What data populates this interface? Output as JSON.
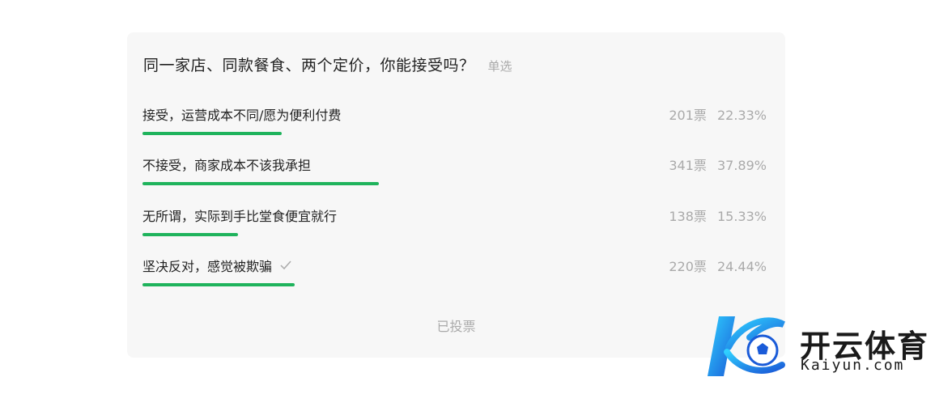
{
  "poll": {
    "question": "同一家店、同款餐食、两个定价，你能接受吗？",
    "type_label": "单选",
    "options": [
      {
        "label": "接受，运营成本不同/愿为便利付费",
        "votes": "201票",
        "percent": "22.33%",
        "fraction": 0.2233,
        "selected": false
      },
      {
        "label": "不接受，商家成本不该我承担",
        "votes": "341票",
        "percent": "37.89%",
        "fraction": 0.3789,
        "selected": false
      },
      {
        "label": "无所谓，实际到手比堂食便宜就行",
        "votes": "138票",
        "percent": "15.33%",
        "fraction": 0.1533,
        "selected": false
      },
      {
        "label": "坚决反对，感觉被欺骗",
        "votes": "220票",
        "percent": "24.44%",
        "fraction": 0.2444,
        "selected": true
      }
    ],
    "status": "已投票",
    "bar_color": "#1fb35c"
  },
  "watermark": {
    "name_cn": "开云体育",
    "name_en": "Kaiyun.com",
    "icon": "kaiyun-logo-icon"
  }
}
